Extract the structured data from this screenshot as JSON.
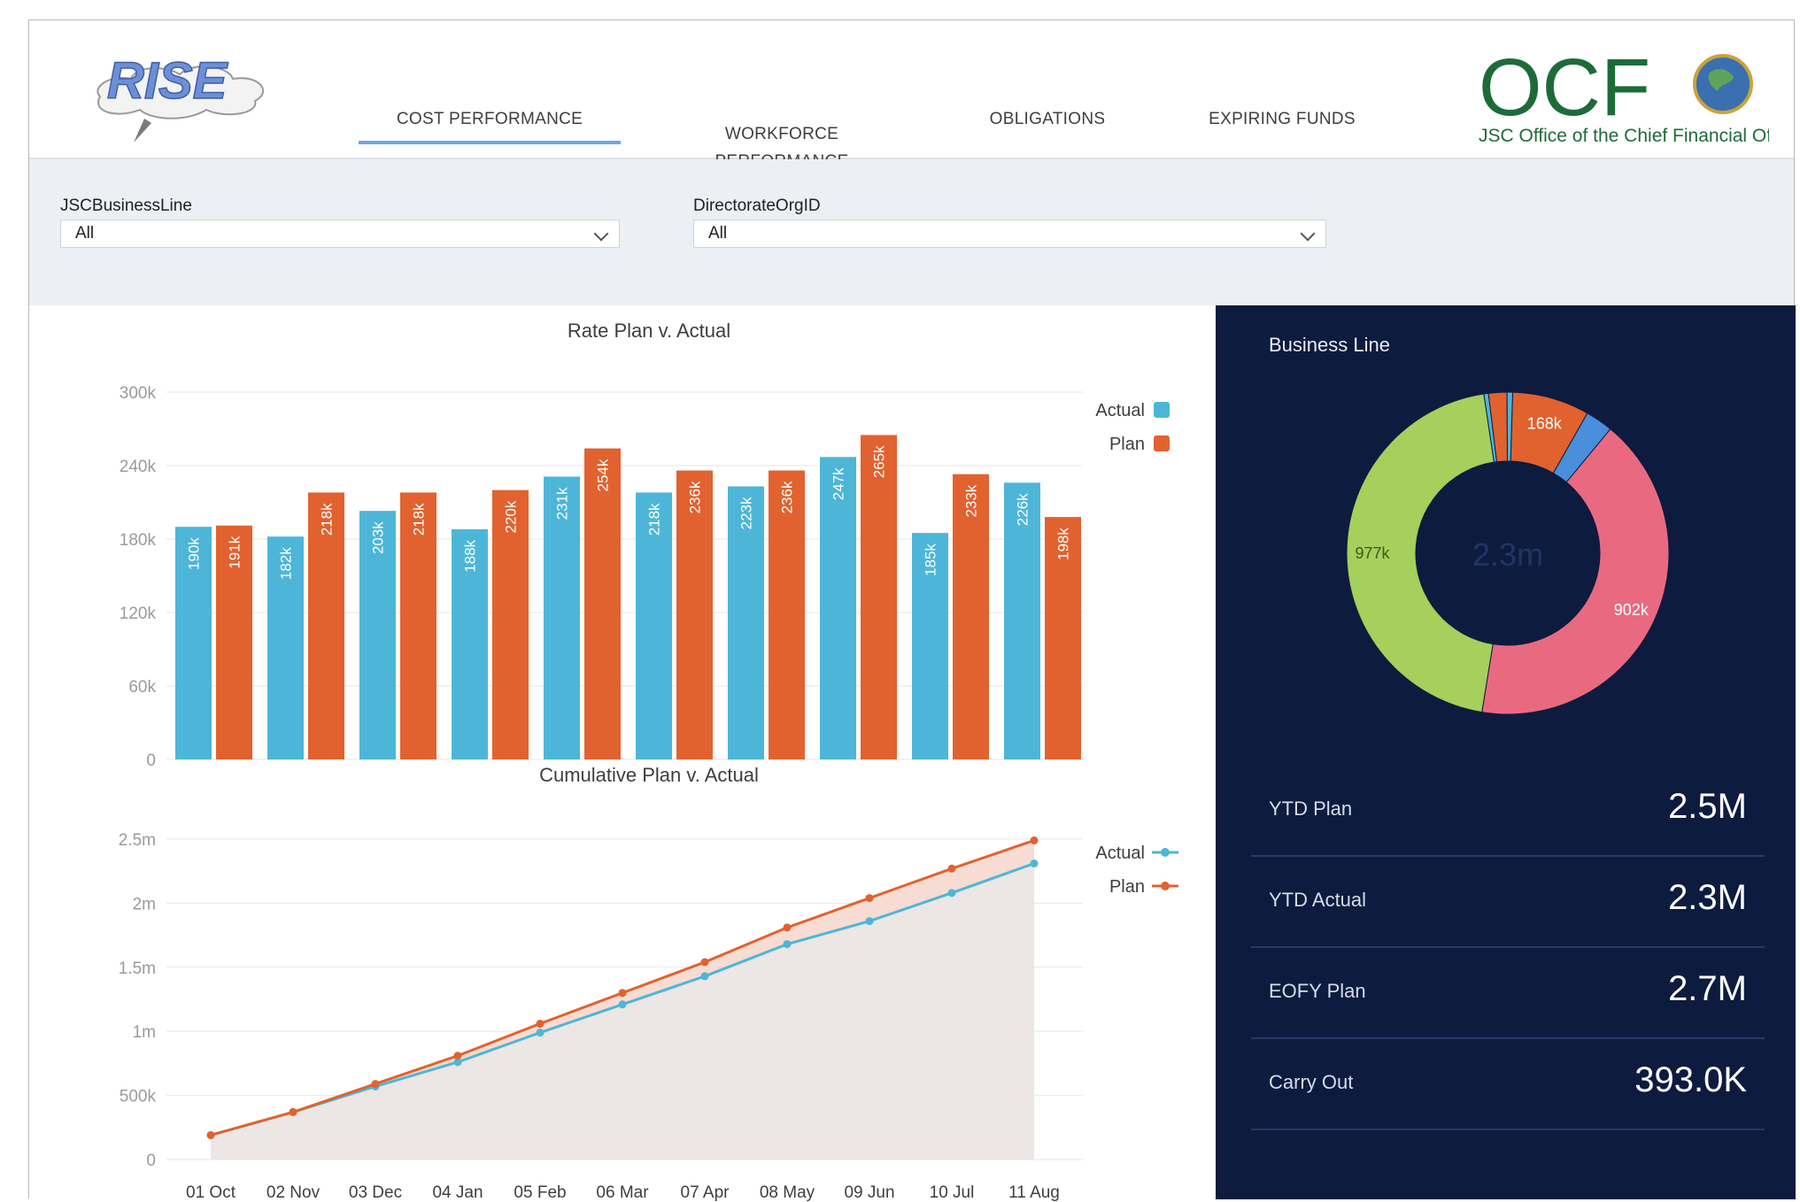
{
  "header": {
    "logo_left": "RISE",
    "logo_right": "OCF",
    "logo_right_caption": "JSC Office of the Chief Financial Officer",
    "tabs": [
      {
        "label": "COST PERFORMANCE",
        "active": true
      },
      {
        "label": "WORKFORCE\nPERFORMANCE",
        "active": false
      },
      {
        "label": "OBLIGATIONS",
        "active": false
      },
      {
        "label": "EXPIRING FUNDS",
        "active": false
      }
    ]
  },
  "filters": {
    "business_line": {
      "label": "JSCBusinessLine",
      "value": "All"
    },
    "directorate": {
      "label": "DirectorateOrgID",
      "value": "All"
    }
  },
  "colors": {
    "actual": "#4db6d8",
    "plan": "#e1622f",
    "panel_bg": "#0d1b3e",
    "donut_green": "#a4d05b",
    "donut_pink": "#e96a80",
    "donut_orange": "#e1622f",
    "donut_blue": "#4a8fdc"
  },
  "chart_data": [
    {
      "type": "bar",
      "title": "Rate Plan v. Actual",
      "categories": [
        "01 Oct",
        "02 Nov",
        "03 Dec",
        "04 Jan",
        "05 Feb",
        "06 Mar",
        "07 Apr",
        "08 May",
        "09 Jun",
        "10 Jul",
        "11 Aug"
      ],
      "series": [
        {
          "name": "Actual",
          "values": [
            190,
            182,
            203,
            188,
            231,
            218,
            223,
            247,
            185,
            226,
            null
          ],
          "labels": [
            "190k",
            "182k",
            "203k",
            "188k",
            "231k",
            "218k",
            "223k",
            "247k",
            "185k",
            "226k",
            ""
          ]
        },
        {
          "name": "Plan",
          "values": [
            191,
            218,
            218,
            220,
            254,
            236,
            236,
            265,
            233,
            198,
            null
          ],
          "labels": [
            "191k",
            "218k",
            "218k",
            "220k",
            "254k",
            "236k",
            "236k",
            "265k",
            "233k",
            "198k",
            ""
          ]
        }
      ],
      "y_ticks": [
        "0",
        "60k",
        "120k",
        "180k",
        "240k",
        "300k"
      ],
      "ylim": [
        0,
        300
      ],
      "legend": [
        "Actual",
        "Plan"
      ],
      "legend_position": "top-right",
      "grid": true
    },
    {
      "type": "line",
      "title": "Cumulative Plan v. Actual",
      "x": [
        "01 Oct",
        "02 Nov",
        "03 Dec",
        "04 Jan",
        "05 Feb",
        "06 Mar",
        "07 Apr",
        "08 May",
        "09 Jun",
        "10 Jul",
        "11 Aug"
      ],
      "series": [
        {
          "name": "Actual",
          "values": [
            0.19,
            0.37,
            0.57,
            0.76,
            0.99,
            1.21,
            1.43,
            1.68,
            1.86,
            2.08,
            2.31
          ]
        },
        {
          "name": "Plan",
          "values": [
            0.19,
            0.37,
            0.59,
            0.81,
            1.06,
            1.3,
            1.54,
            1.81,
            2.04,
            2.27,
            2.49
          ]
        }
      ],
      "y_ticks": [
        "0",
        "500k",
        "1m",
        "1.5m",
        "2m",
        "2.5m"
      ],
      "ylim": [
        0,
        2.5
      ],
      "legend": [
        "Actual",
        "Plan"
      ],
      "legend_position": "top-right",
      "grid": true
    },
    {
      "type": "pie",
      "title": "Business Line",
      "center_label": "2.3m",
      "slices": [
        {
          "value": 168,
          "label": "168k",
          "color": "#e1622f"
        },
        {
          "value": 60,
          "label": "",
          "color": "#4a8fdc"
        },
        {
          "value": 902,
          "label": "902k",
          "color": "#e96a80"
        },
        {
          "value": 977,
          "label": "977k",
          "color": "#a4d05b"
        },
        {
          "value": 10,
          "label": "",
          "color": "#4db6d8"
        },
        {
          "value": 40,
          "label": "",
          "color": "#e1622f"
        },
        {
          "value": 12,
          "label": "",
          "color": "#4db6d8"
        }
      ]
    }
  ],
  "kpis": [
    {
      "label": "YTD Plan",
      "value": "2.5M"
    },
    {
      "label": "YTD Actual",
      "value": "2.3M"
    },
    {
      "label": "EOFY Plan",
      "value": "2.7M"
    },
    {
      "label": "Carry Out",
      "value": "393.0K"
    }
  ]
}
